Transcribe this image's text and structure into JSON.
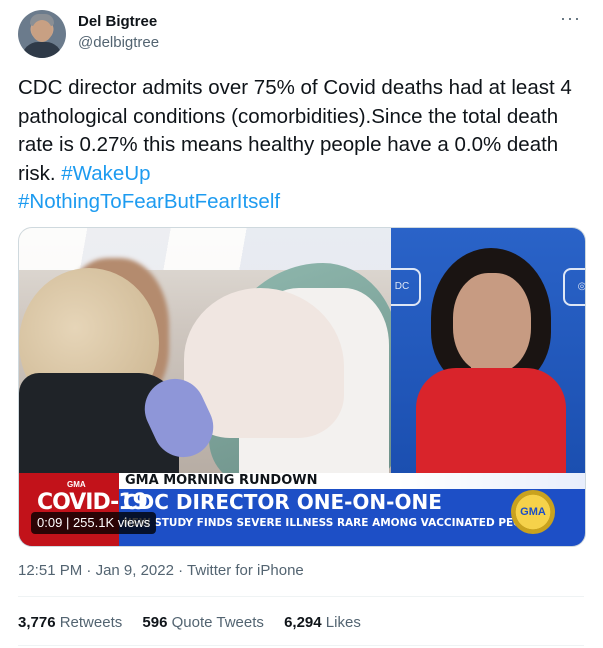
{
  "author": {
    "name": "Del Bigtree",
    "handle": "@delbigtree",
    "avatar_icon": "profile-photo"
  },
  "more_icon": "more-dots-icon",
  "tweet": {
    "text_main": "CDC director admits over 75% of Covid deaths had at least 4 pathological conditions (comorbidities).Since the total death rate is 0.27% this means healthy people have a 0.0% death risk. ",
    "hashtag_1": "#WakeUp",
    "hashtag_2": "#NothingToFearButFearItself"
  },
  "video": {
    "covid_tag_small": "GMA",
    "covid_tag": "COVID-19",
    "rundown": "GMA MORNING RUNDOWN",
    "headline": "CDC DIRECTOR ONE-ON-ONE",
    "subhead": "NEW STUDY FINDS SEVERE ILLNESS RARE AMONG VACCINATED PEOPLE",
    "logo": "GMA",
    "duration": "0:09",
    "views": "255.1K views",
    "corner_logo": "DC"
  },
  "meta": {
    "time": "12:51 PM",
    "date": "Jan 9, 2022",
    "source": "Twitter for iPhone",
    "separator": "·"
  },
  "stats": {
    "retweets_count": "3,776",
    "retweets_label": "Retweets",
    "quotes_count": "596",
    "quotes_label": "Quote Tweets",
    "likes_count": "6,294",
    "likes_label": "Likes"
  },
  "colors": {
    "link": "#1d9bf0",
    "text": "#0f1419",
    "secondary": "#536471"
  }
}
